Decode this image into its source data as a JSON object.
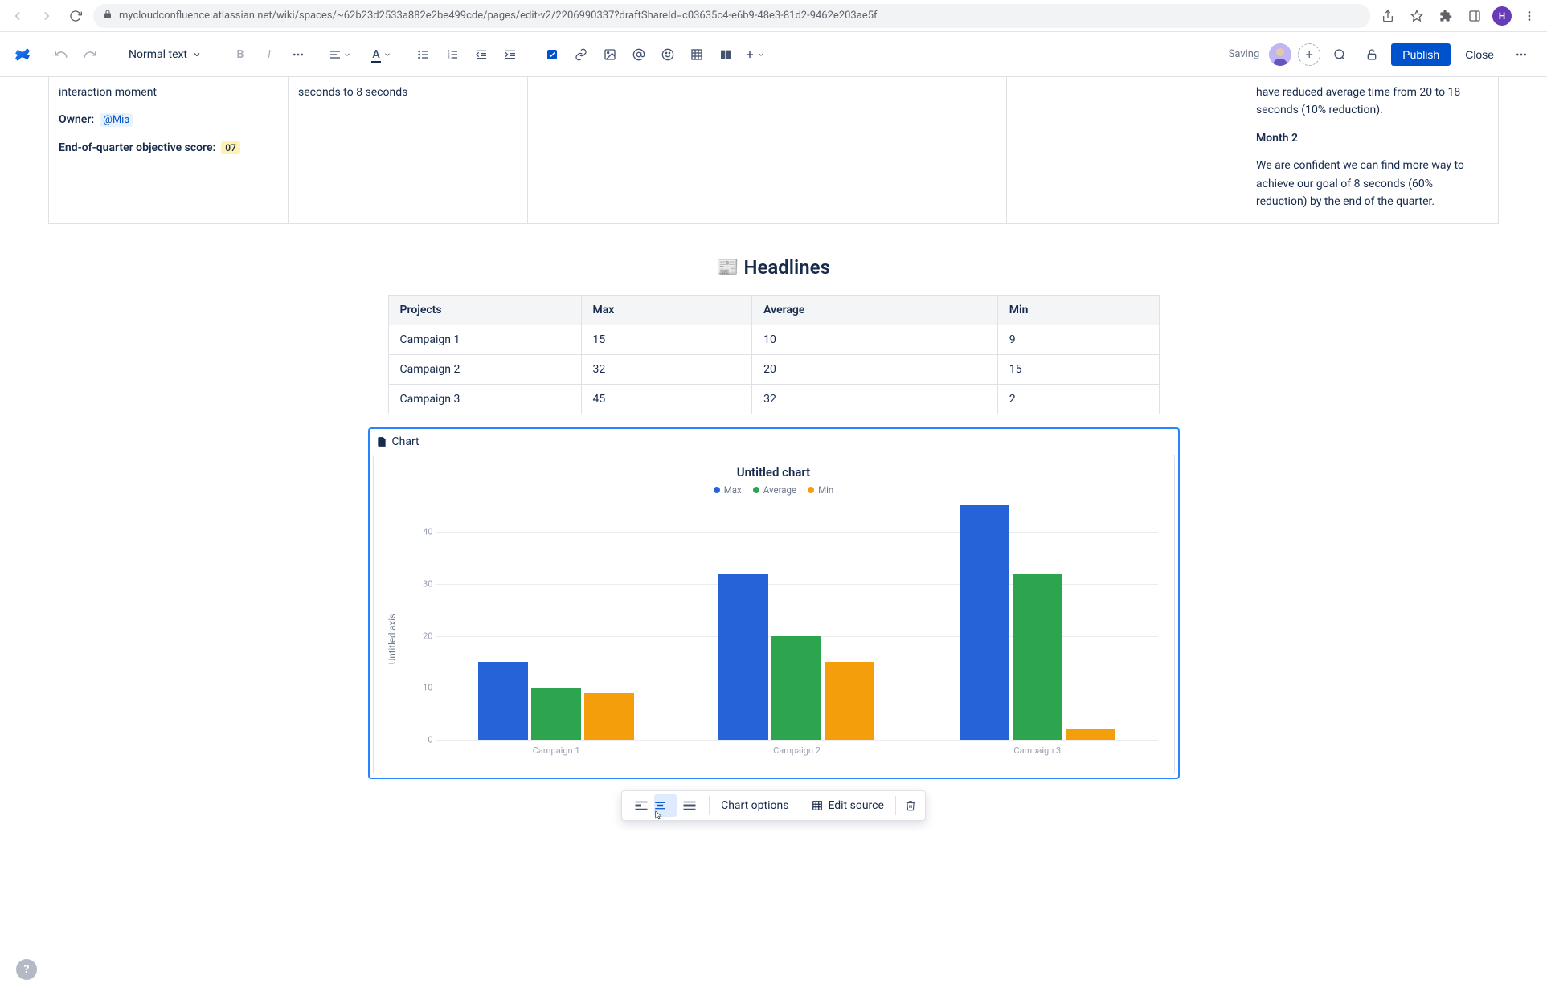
{
  "browser": {
    "url": "mycloudconfluence.atlassian.net/wiki/spaces/~62b23d2533a882e2be499cde/pages/edit-v2/2206990337?draftShareId=c03635c4-e6b9-48e3-81d2-9462e203ae5f",
    "avatar_initial": "H"
  },
  "toolbar": {
    "text_style": "Normal text",
    "saving": "Saving",
    "publish": "Publish",
    "close": "Close"
  },
  "topgrid": {
    "cell0_line1": "interaction moment",
    "cell0_owner_label": "Owner:",
    "cell0_owner_value": "@Mia",
    "cell0_eoq_label": "End-of-quarter objective score:",
    "cell0_eoq_value": "07",
    "cell1_line": "seconds to 8 seconds",
    "cell5_p1": "have reduced average time from 20 to 18 seconds (10% reduction).",
    "cell5_month2": "Month 2",
    "cell5_p2": "We are confident we can find more way to achieve our goal of 8 seconds (60% reduction) by the end of the quarter."
  },
  "headlines": {
    "emoji": "📰",
    "title": "Headlines"
  },
  "table": {
    "headers": [
      "Projects",
      "Max",
      "Average",
      "Min"
    ],
    "rows": [
      [
        "Campaign 1",
        "15",
        "10",
        "9"
      ],
      [
        "Campaign 2",
        "32",
        "20",
        "15"
      ],
      [
        "Campaign 3",
        "45",
        "32",
        "2"
      ]
    ]
  },
  "chart_panel": {
    "macro_label": "Chart",
    "title": "Untitled chart",
    "y_axis_label": "Untitled axis"
  },
  "chart_toolbar": {
    "options": "Chart options",
    "edit_source": "Edit source"
  },
  "colors": {
    "blue": "#2563d9",
    "green": "#2da44e",
    "orange": "#f59e0b"
  },
  "chart_data": {
    "type": "bar",
    "title": "Untitled chart",
    "ylabel": "Untitled axis",
    "xlabel": "",
    "categories": [
      "Campaign 1",
      "Campaign 2",
      "Campaign 3"
    ],
    "series": [
      {
        "name": "Max",
        "values": [
          15,
          32,
          45
        ],
        "color": "#2563d9"
      },
      {
        "name": "Average",
        "values": [
          10,
          20,
          32
        ],
        "color": "#2da44e"
      },
      {
        "name": "Min",
        "values": [
          9,
          15,
          2
        ],
        "color": "#f59e0b"
      }
    ],
    "ylim": [
      0,
      45
    ],
    "yticks": [
      0,
      10,
      20,
      30,
      40
    ]
  }
}
